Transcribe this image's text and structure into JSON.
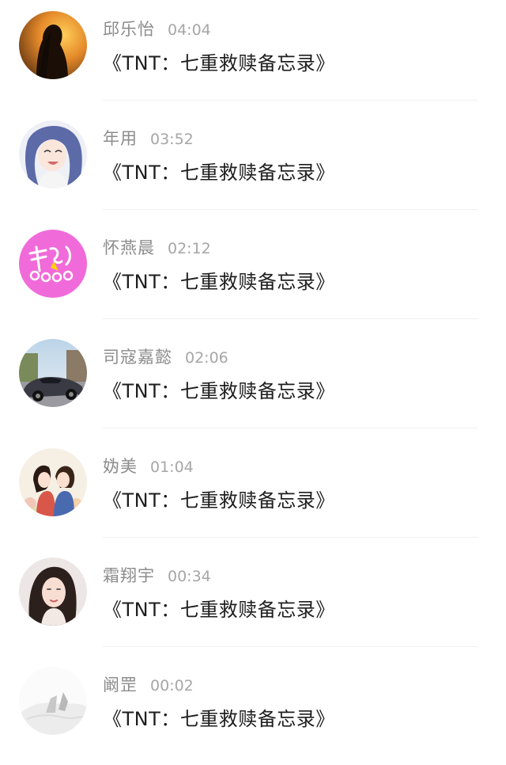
{
  "comments": [
    {
      "name": "邱乐怡",
      "time": "04:04",
      "message": "《TNT：七重救赎备忘录》",
      "avatar": "silhouette-sunset-icon"
    },
    {
      "name": "年用",
      "time": "03:52",
      "message": "《TNT：七重救赎备忘录》",
      "avatar": "anime-girl-icon"
    },
    {
      "name": "怀燕晨",
      "time": "02:12",
      "message": "《TNT：七重救赎备忘录》",
      "avatar": "pink-lettering-icon"
    },
    {
      "name": "司寇嘉懿",
      "time": "02:06",
      "message": "《TNT：七重救赎备忘录》",
      "avatar": "sports-car-icon"
    },
    {
      "name": "妫美",
      "time": "01:04",
      "message": "《TNT：七重救赎备忘录》",
      "avatar": "illustrated-couple-icon"
    },
    {
      "name": "霜翔宇",
      "time": "00:34",
      "message": "《TNT：七重救赎备忘录》",
      "avatar": "portrait-girl-icon"
    },
    {
      "name": "阚罡",
      "time": "00:02",
      "message": "《TNT：七重救赎备忘录》",
      "avatar": "grey-landscape-icon"
    }
  ]
}
